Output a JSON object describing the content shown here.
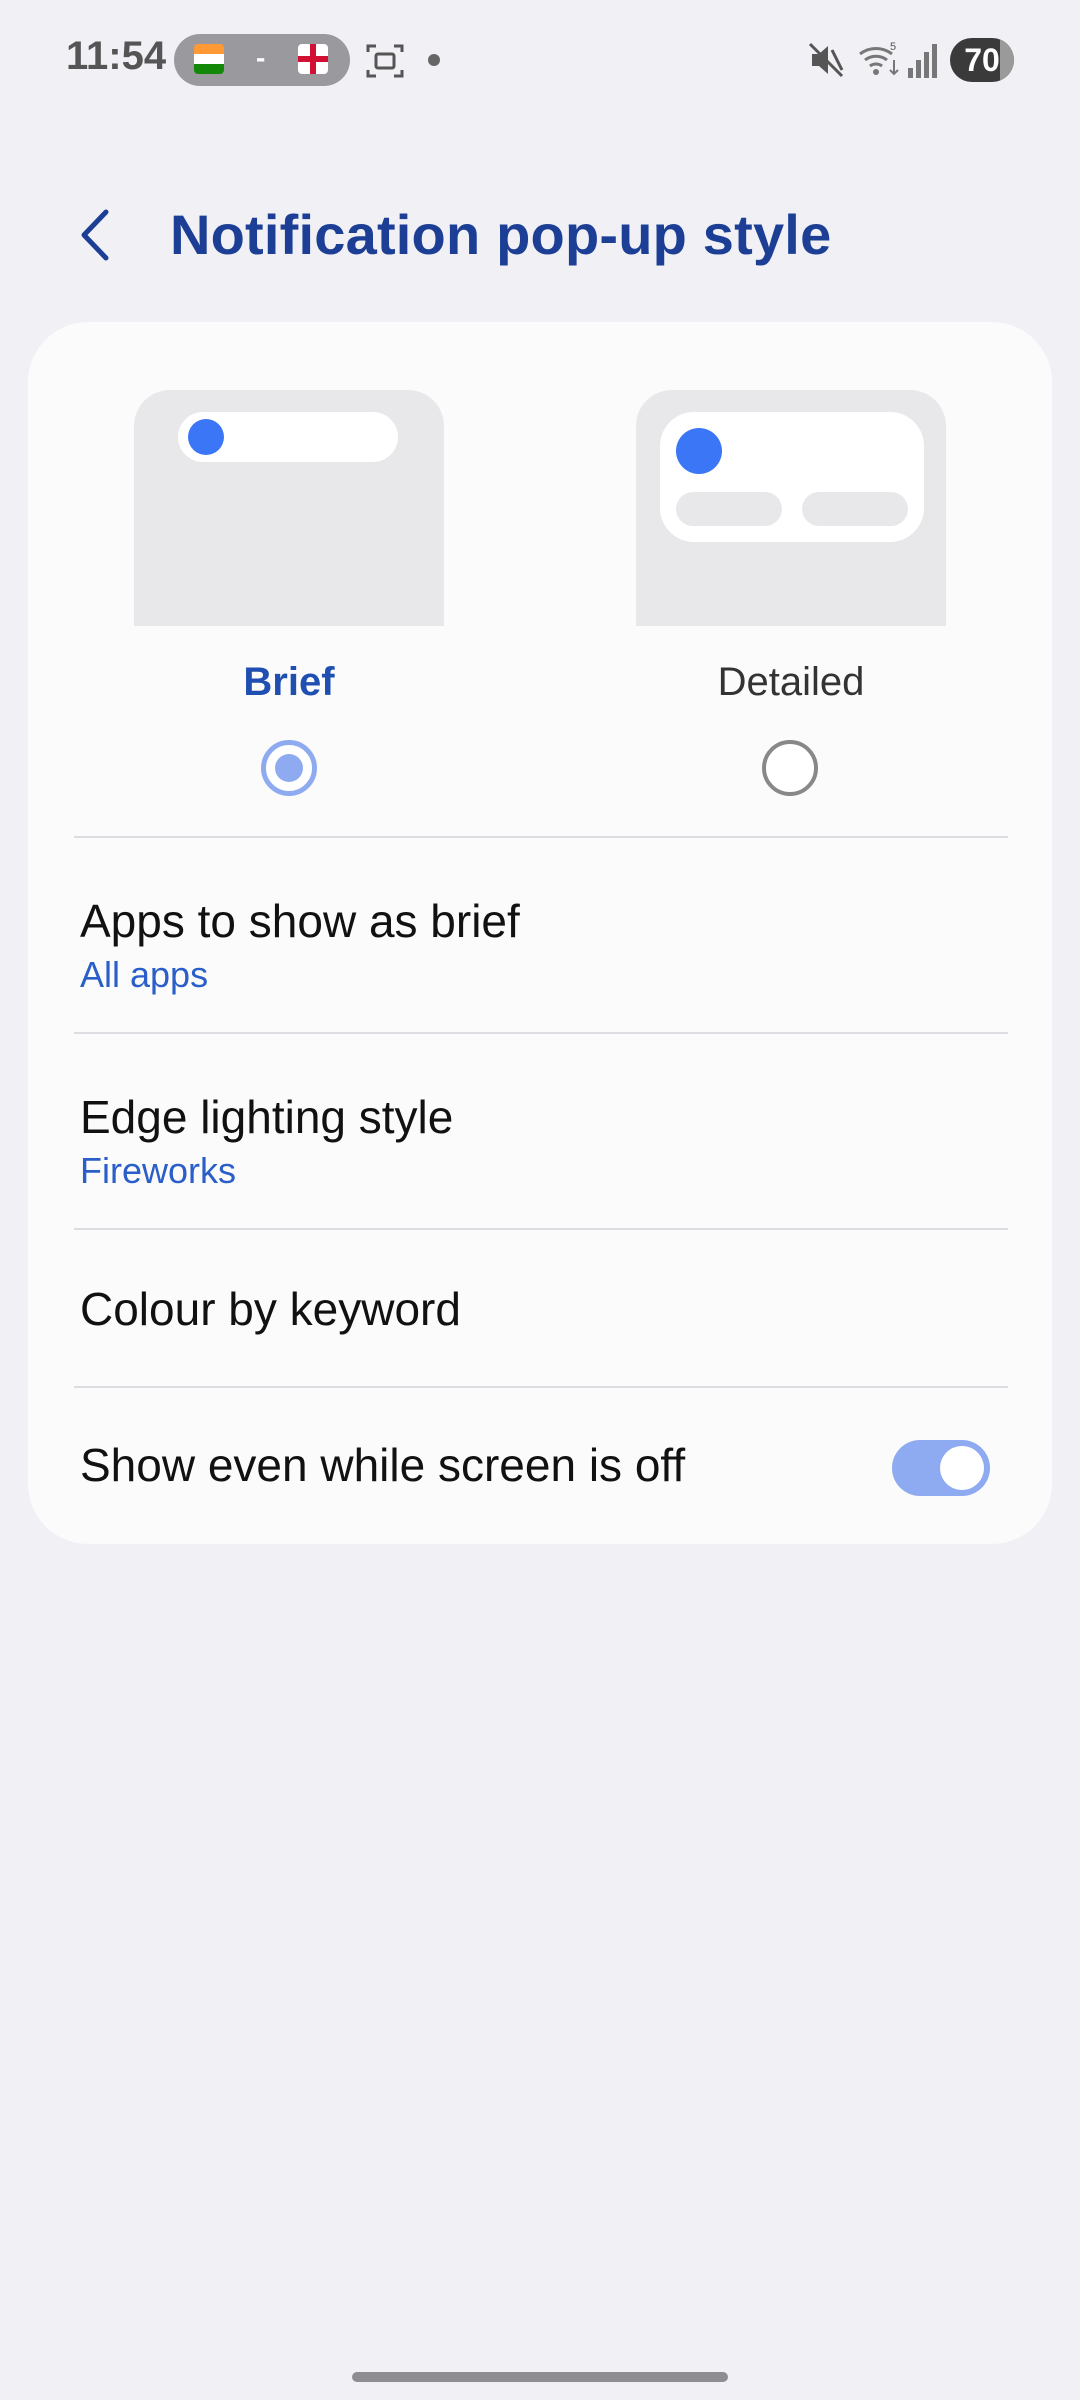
{
  "status_bar": {
    "time": "11:54",
    "score_separator": "-",
    "battery_level": "70",
    "wifi_label": "5"
  },
  "header": {
    "title": "Notification pop-up style"
  },
  "styles": {
    "selected": "Brief",
    "options": [
      {
        "label": "Brief",
        "selected": true
      },
      {
        "label": "Detailed",
        "selected": false
      }
    ]
  },
  "settings": [
    {
      "title": "Apps to show as brief",
      "subtitle": "All apps"
    },
    {
      "title": "Edge lighting style",
      "subtitle": "Fireworks"
    },
    {
      "title": "Colour by keyword"
    },
    {
      "title": "Show even while screen is off",
      "toggle_on": true
    }
  ],
  "colors": {
    "accent": "#1c3f95",
    "link": "#2a5ec8",
    "dot": "#3b76f6",
    "toggle": "#8eaaf0"
  }
}
